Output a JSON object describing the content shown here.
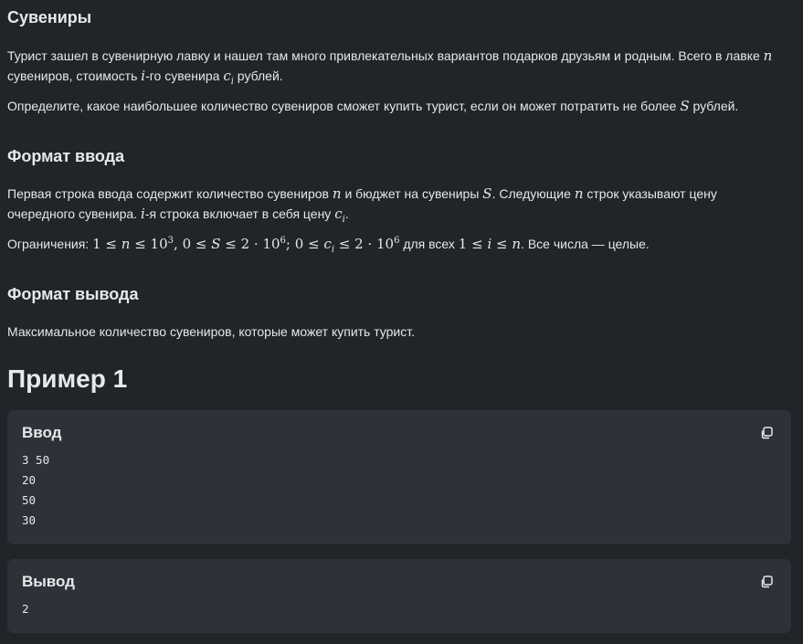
{
  "problem": {
    "title": "Сувениры",
    "statement": {
      "p1_a": "Турист зашел в сувенирную лавку и нашел там много привлекательных вариантов подарков друзьям и родным. Всего в лавке ",
      "p1_var_n": "n",
      "p1_b": "сувениров, стоимость ",
      "p1_var_i": "i",
      "p1_c": "-го сувенира ",
      "p1_var_c": "c",
      "p1_var_c_sub": "i",
      "p1_d": " рублей.",
      "p2_a": "Определите, какое наибольшее количество сувениров сможет купить турист, если он может потратить не более ",
      "p2_var_s": "S",
      "p2_b": " рублей."
    },
    "input_format": {
      "heading": "Формат ввода",
      "p1_a": "Первая строка ввода содержит количество сувениров ",
      "p1_var_n": "n",
      "p1_b": " и бюджет на сувениры ",
      "p1_var_s": "S",
      "p1_c": ". Следующие ",
      "p1_var_n2": "n",
      "p1_d": " строк указывают цену",
      "p1_e": "очередного сувенира. ",
      "p1_var_i": "i",
      "p1_f": "-я строка включает в себя цену ",
      "p1_var_c": "c",
      "p1_var_c_sub": "i",
      "p1_g": ".",
      "constraints_label": "Ограничения: ",
      "constraints_tail": " для всех ",
      "constraints_end": ". Все числа — целые."
    },
    "output_format": {
      "heading": "Формат вывода",
      "text": "Максимальное количество сувениров, которые может купить турист."
    },
    "example": {
      "title": "Пример 1",
      "input_label": "Ввод",
      "input_lines": "3 50\n20\n50\n30",
      "output_label": "Вывод",
      "output_lines": "2"
    }
  },
  "icons": {
    "copy": "copy-icon"
  },
  "colors": {
    "background": "#212428",
    "card": "#2e3137",
    "text": "#e6e8eb"
  }
}
